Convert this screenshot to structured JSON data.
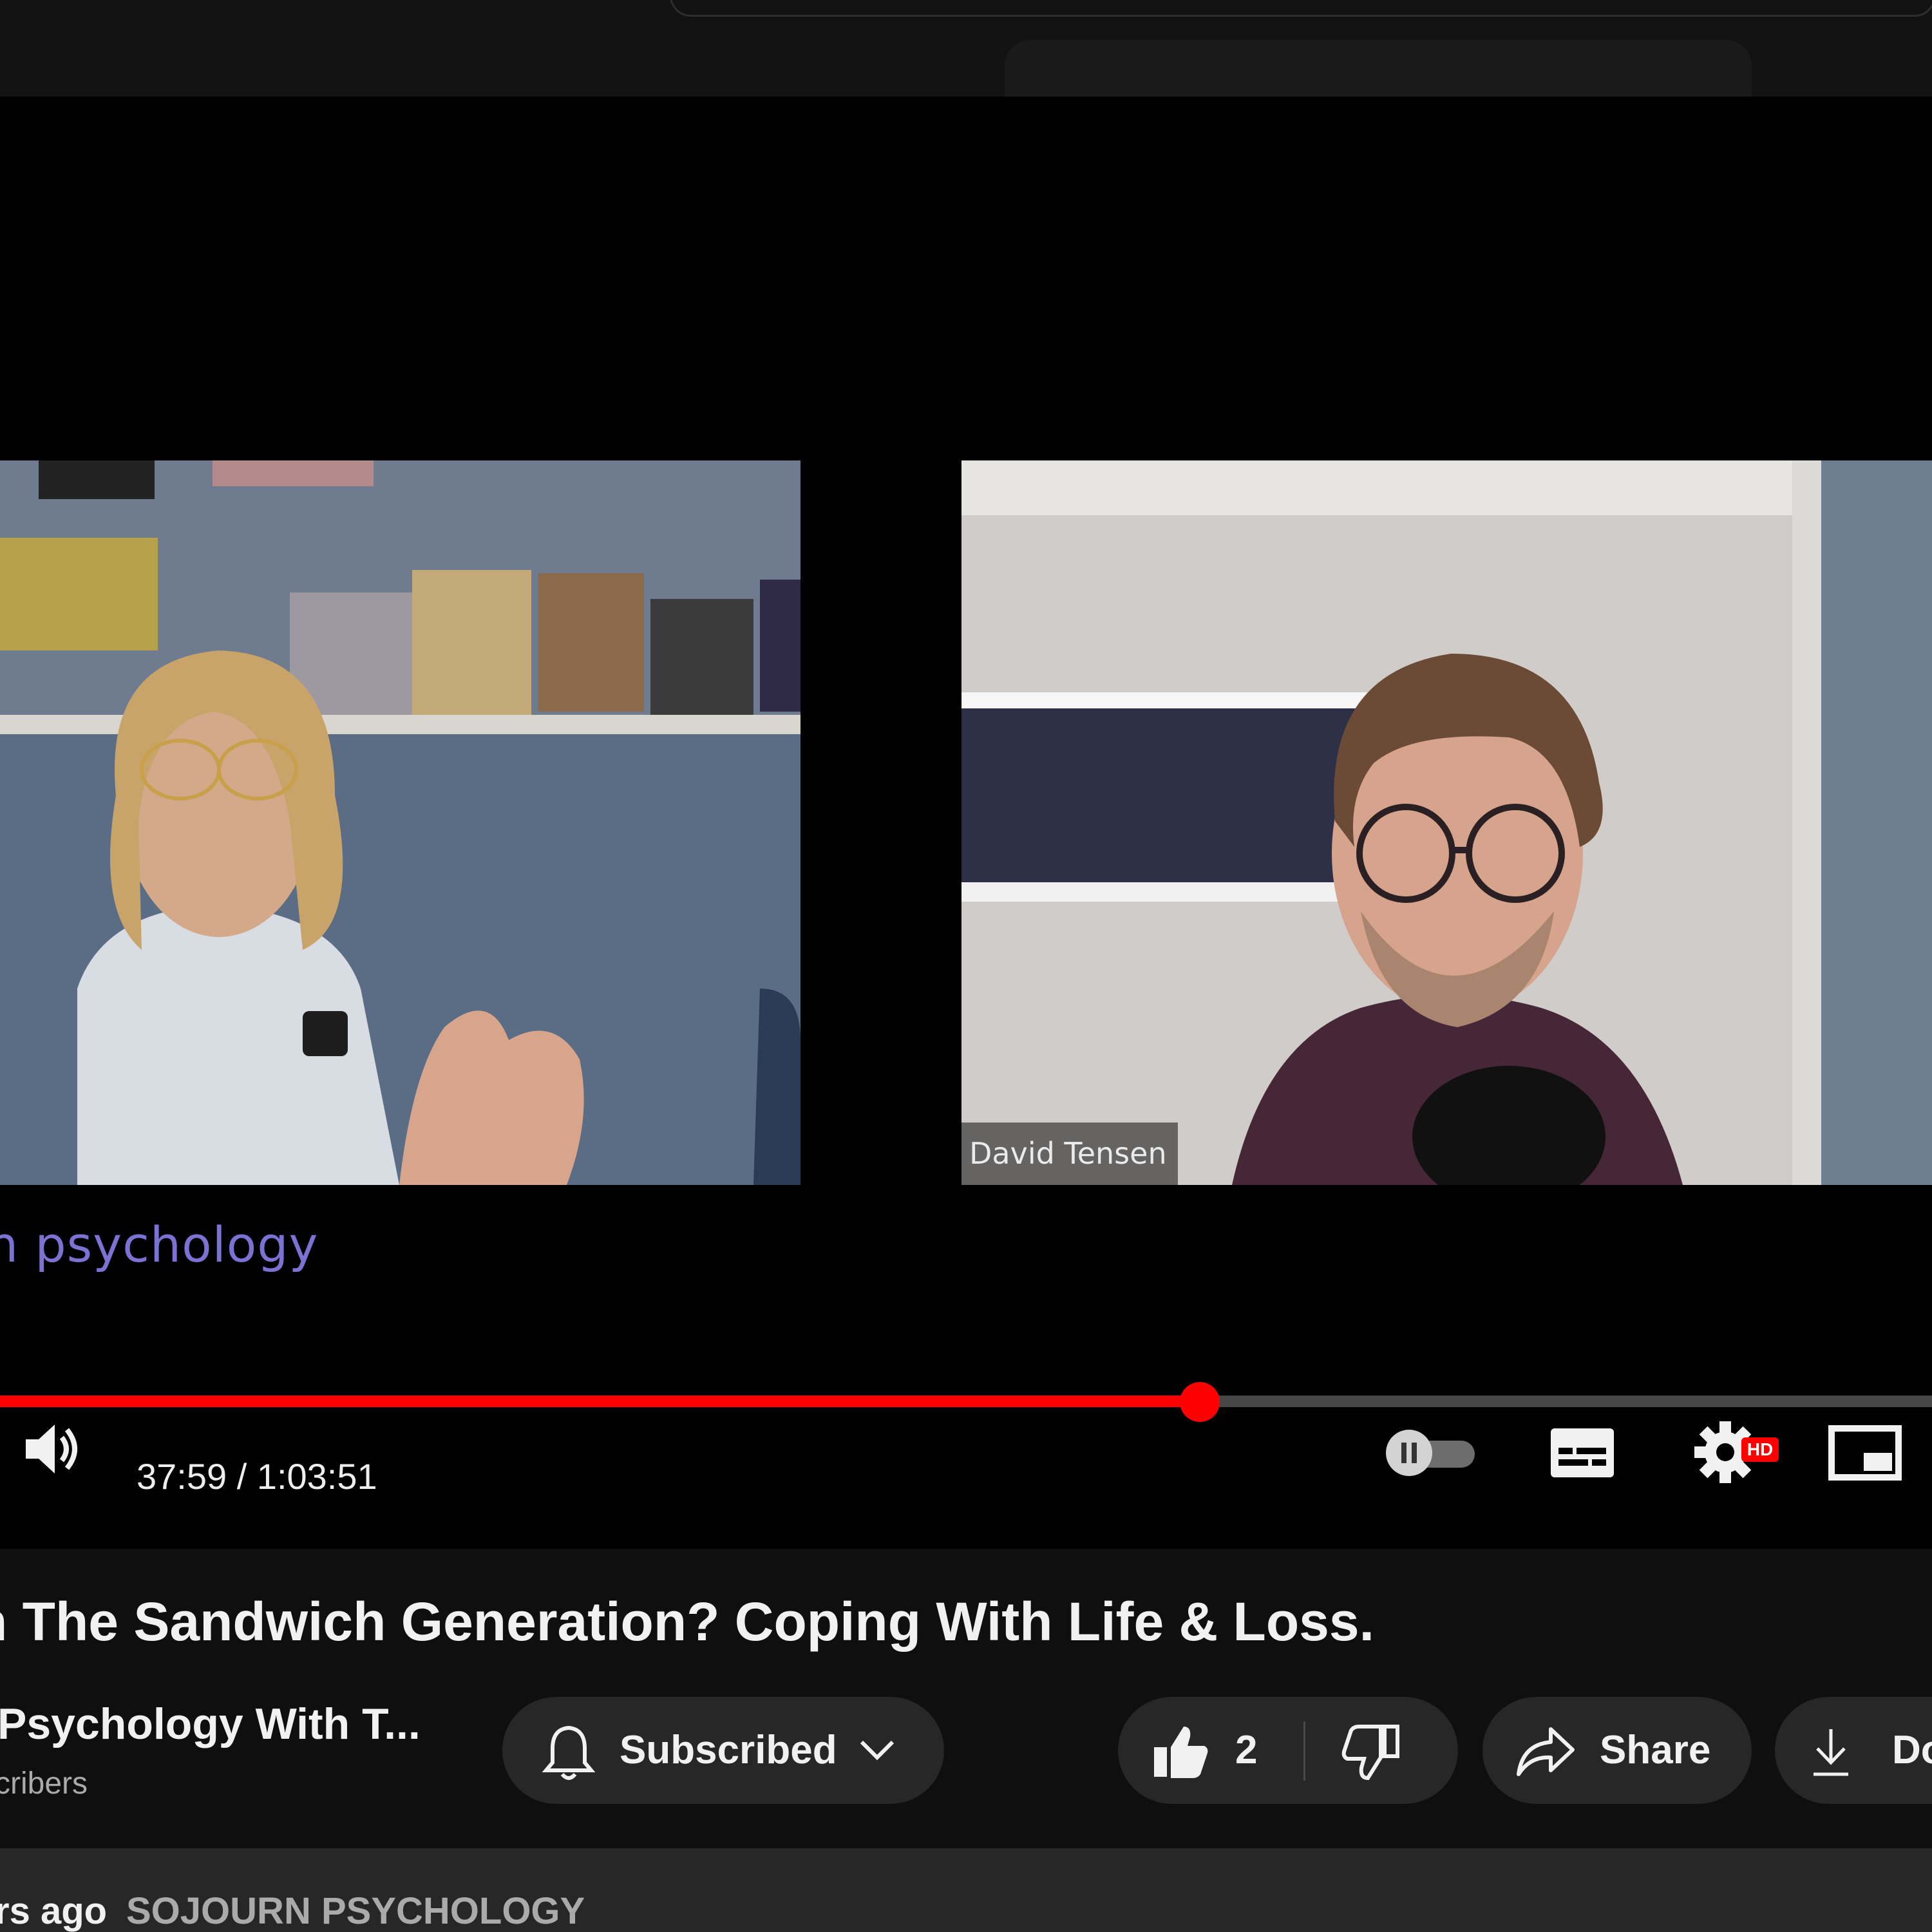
{
  "player": {
    "name_tag": "David Tensen",
    "watermark_text": "n psychology",
    "progress_fraction": 0.621,
    "time_display": "37:59 / 1:03:51",
    "hd_badge": "HD",
    "icons": [
      "volume-icon",
      "autoplay-toggle-icon",
      "captions-icon",
      "settings-icon",
      "miniplayer-icon"
    ]
  },
  "video": {
    "title": "n The Sandwich Generation? Coping With Life & Loss.",
    "channel_name": "Psychology With T...",
    "subscriber_text": "cribers"
  },
  "actions": {
    "subscribe_label": "Subscribed",
    "like_count": "2",
    "share_label": "Share",
    "download_label": "Do"
  },
  "description": {
    "date_text": "rs ago",
    "tag_text": "SOJOURN PSYCHOLOGY"
  },
  "colors": {
    "accent": "#ff0000",
    "background": "#0f0f0f",
    "pill": "#272727",
    "watermark": "#7b72d4"
  }
}
